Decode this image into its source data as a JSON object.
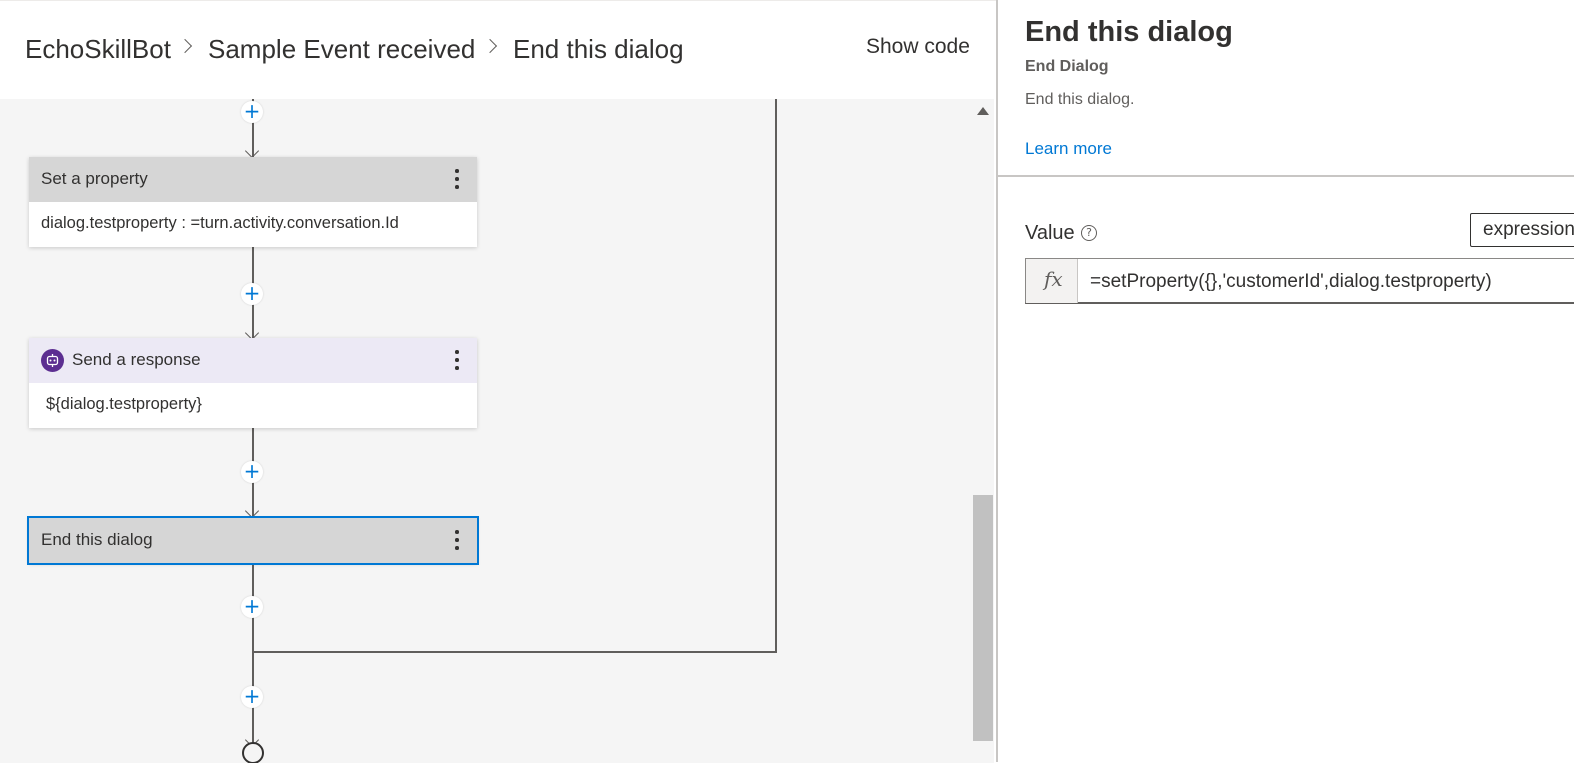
{
  "breadcrumb": {
    "items": [
      "EchoSkillBot",
      "Sample Event received",
      "End this dialog"
    ]
  },
  "header": {
    "show_code_label": "Show code"
  },
  "flow": {
    "nodes": [
      {
        "title": "Set a property",
        "body": "dialog.testproperty : =turn.activity.conversation.Id"
      },
      {
        "title": "Send a response",
        "body": "${dialog.testproperty}",
        "icon": "bot-icon"
      },
      {
        "title": "End this dialog",
        "selected": true
      }
    ],
    "add_label": "+"
  },
  "panel": {
    "title": "End this dialog",
    "subtitle": "End Dialog",
    "description": "End this dialog.",
    "learn_more": "Learn more",
    "field": {
      "label": "Value",
      "help_glyph": "?",
      "type": "expression",
      "fx_label": "fx",
      "value": "=setProperty({},'customerId',dialog.testproperty)"
    }
  },
  "colors": {
    "accent": "#0078d4",
    "bot_icon": "#5c2e91",
    "node_header": "#d6d6d6",
    "response_header": "#ece9f5"
  }
}
